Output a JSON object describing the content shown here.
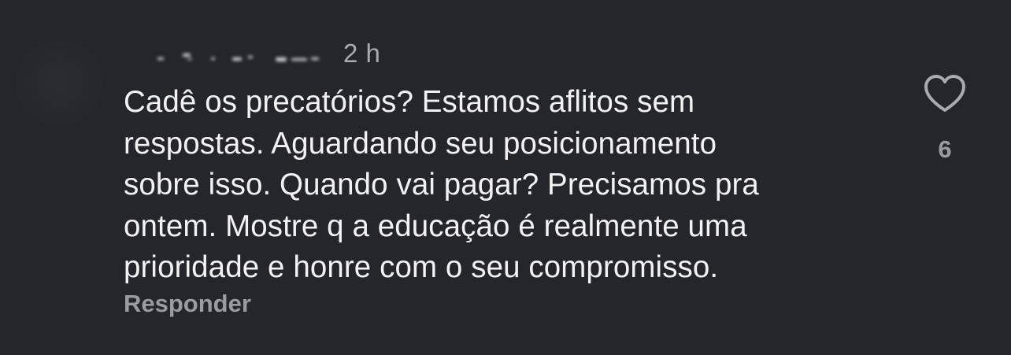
{
  "comment": {
    "timestamp": "2 h",
    "text": "Cadê os precatórios? Estamos aflitos sem\nrespostas. Aguardando seu posicionamento\nsobre isso. Quando vai pagar? Precisamos pra\nontem. Mostre q a educação é realmente uma\nprioridade e honre com o seu compromisso.",
    "reply_label": "Responder",
    "like_count": "6",
    "like_icon": "heart-outline-icon"
  },
  "colors": {
    "background": "#24262b",
    "text": "#f2f2f2",
    "muted": "#9a9ca3"
  }
}
